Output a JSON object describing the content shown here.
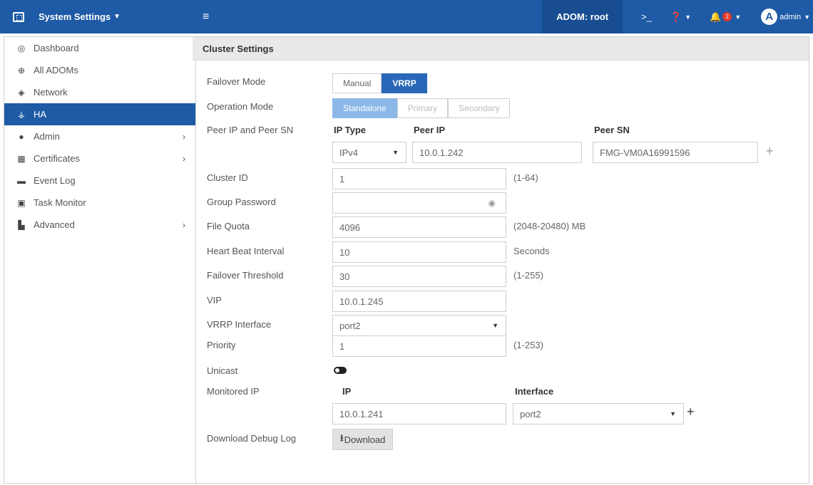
{
  "topbar": {
    "app_title": "System Settings",
    "adom_label": "ADOM: root",
    "notification_count": "2",
    "user_initial": "A",
    "user_name": "admin"
  },
  "sidebar": {
    "items": [
      {
        "label": "Dashboard",
        "icon": "dashboard-icon"
      },
      {
        "label": "All ADOMs",
        "icon": "globe-icon"
      },
      {
        "label": "Network",
        "icon": "network-icon"
      },
      {
        "label": "HA",
        "icon": "ha-icon"
      },
      {
        "label": "Admin",
        "icon": "user-icon"
      },
      {
        "label": "Certificates",
        "icon": "certificate-icon"
      },
      {
        "label": "Event Log",
        "icon": "log-icon"
      },
      {
        "label": "Task Monitor",
        "icon": "monitor-icon"
      },
      {
        "label": "Advanced",
        "icon": "advanced-icon"
      }
    ],
    "active": "HA"
  },
  "panel": {
    "title": "Cluster Settings",
    "failover_mode": {
      "label": "Failover Mode",
      "options": [
        "Manual",
        "VRRP"
      ],
      "selected": "VRRP"
    },
    "operation_mode": {
      "label": "Operation Mode",
      "options": [
        "Standalone",
        "Primary",
        "Secondary"
      ],
      "selected": "Standalone"
    },
    "peer": {
      "label": "Peer IP and Peer SN",
      "ip_type_header": "IP Type",
      "peer_ip_header": "Peer IP",
      "peer_sn_header": "Peer SN",
      "ip_type": "IPv4",
      "peer_ip": "10.0.1.242",
      "peer_sn": "FMG-VM0A16991596"
    },
    "cluster_id": {
      "label": "Cluster ID",
      "value": "1",
      "hint": "(1-64)"
    },
    "group_password": {
      "label": "Group Password",
      "value": ""
    },
    "file_quota": {
      "label": "File Quota",
      "value": "4096",
      "hint": "(2048-20480) MB"
    },
    "heartbeat": {
      "label": "Heart Beat Interval",
      "value": "10",
      "hint": "Seconds"
    },
    "failover_threshold": {
      "label": "Failover Threshold",
      "value": "30",
      "hint": "(1-255)"
    },
    "vip": {
      "label": "VIP",
      "value": "10.0.1.245"
    },
    "vrrp_interface": {
      "label": "VRRP Interface",
      "value": "port2"
    },
    "priority": {
      "label": "Priority",
      "value": "1",
      "hint": "(1-253)"
    },
    "unicast": {
      "label": "Unicast",
      "enabled": false
    },
    "monitored_ip": {
      "label": "Monitored IP",
      "ip_header": "IP",
      "interface_header": "Interface",
      "ip": "10.0.1.241",
      "interface": "port2"
    },
    "debug_log": {
      "label": "Download Debug Log",
      "button": "Download"
    }
  }
}
